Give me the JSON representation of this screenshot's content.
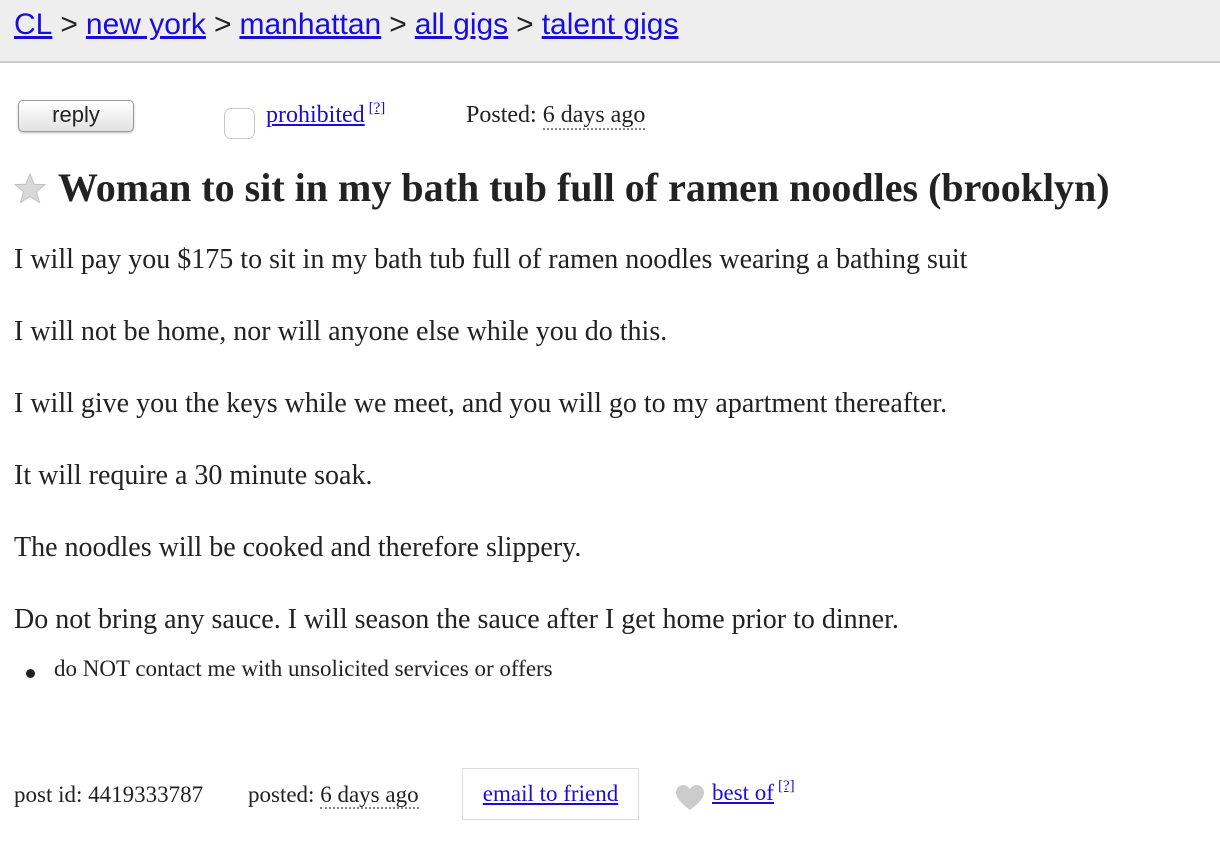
{
  "breadcrumb": {
    "items": [
      "CL",
      "new york",
      "manhattan",
      "all gigs",
      "talent gigs"
    ],
    "separator": ">"
  },
  "actions": {
    "reply_label": "reply",
    "prohibited_label": "prohibited",
    "help_marker": "[?]",
    "posted_label": "Posted:",
    "posted_value": "6 days ago"
  },
  "post": {
    "title": "Woman to sit in my bath tub full of ramen noodles (brooklyn)",
    "paragraphs": [
      "I will pay you $175 to sit in my bath tub full of ramen noodles wearing a bathing suit",
      "I will not be home, nor will anyone else while you do this.",
      "I will give you the keys while we meet, and you will go to my apartment thereafter.",
      "It will require a 30 minute soak.",
      "The noodles will be cooked and therefore slippery.",
      "Do not bring any sauce. I will season the sauce after I get home prior to dinner."
    ],
    "notices": [
      "do NOT contact me with unsolicited services or offers"
    ]
  },
  "footer": {
    "post_id_label": "post id:",
    "post_id": "4419333787",
    "posted_label": "posted:",
    "posted_value": "6 days ago",
    "email_label": "email to friend",
    "best_of_label": "best of",
    "help_marker": "[?]"
  },
  "colors": {
    "link": "#1a0ddb",
    "topbar_bg": "#eeeeee",
    "text": "#222222",
    "icon_gray": "#cccccc"
  },
  "icons": {
    "favorite": "star-icon",
    "best_of": "heart-icon"
  }
}
